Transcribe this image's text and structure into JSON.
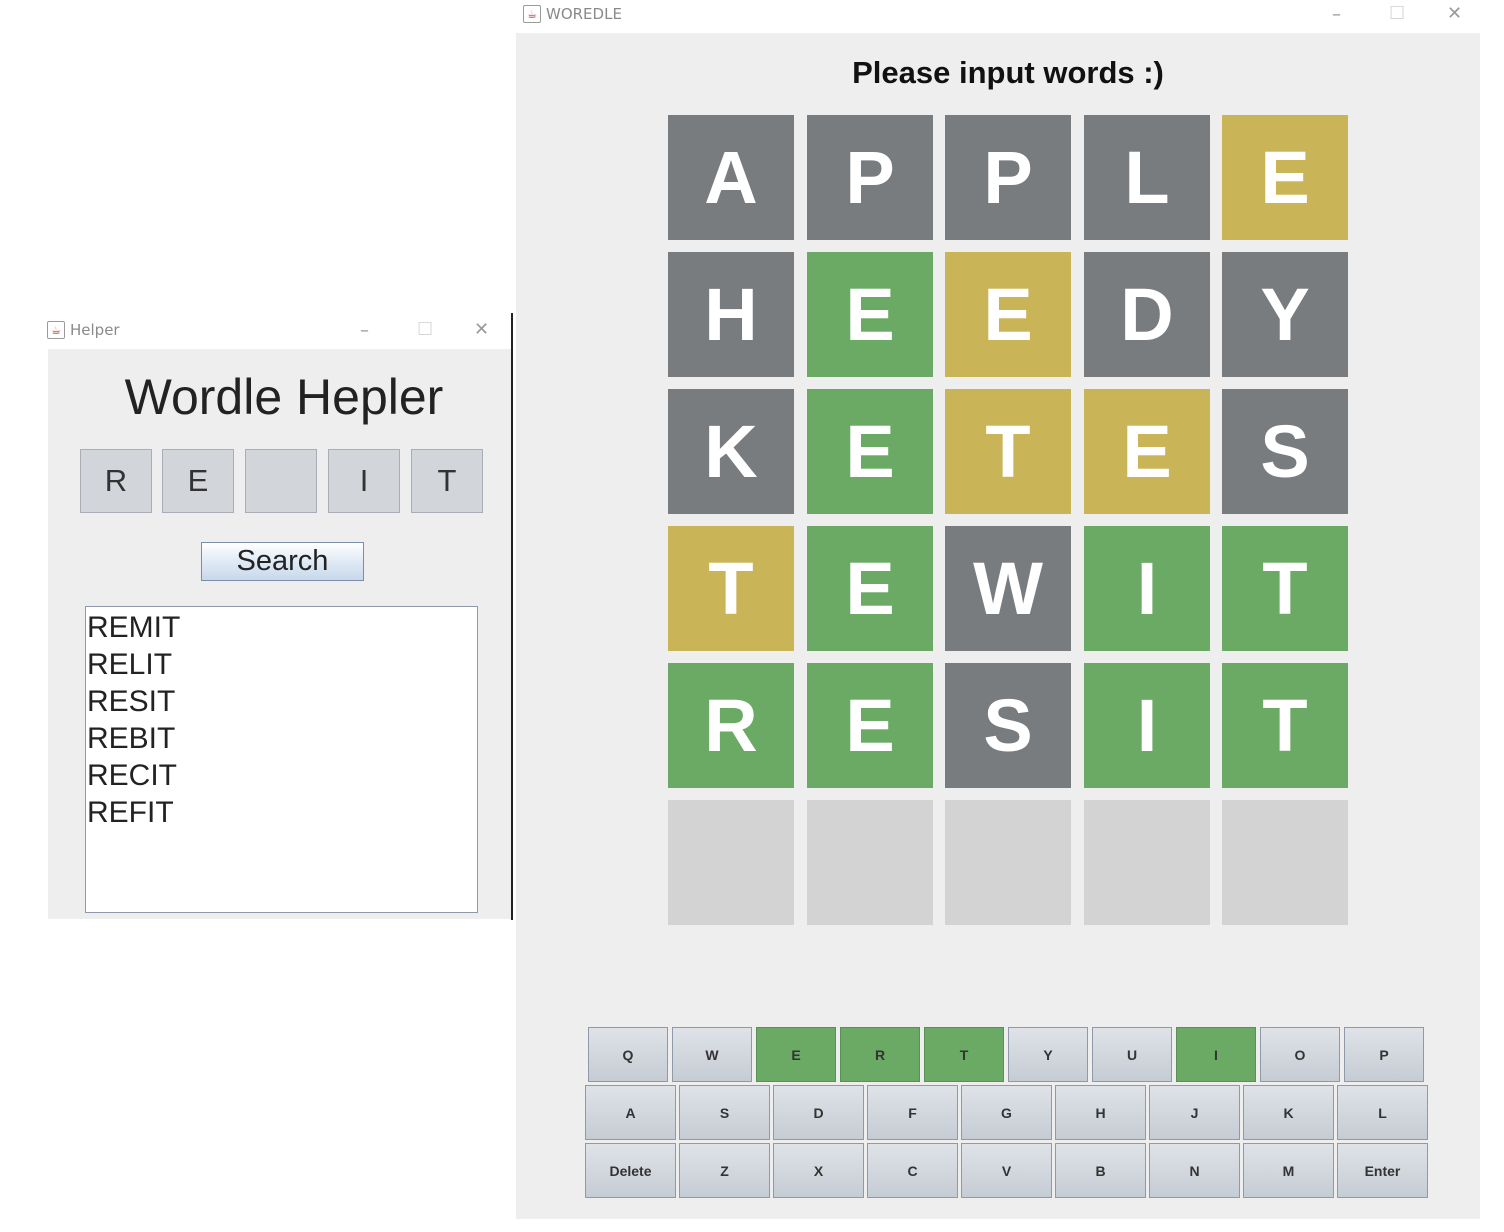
{
  "woredle_window": {
    "title": "WOREDLE",
    "heading": "Please input words :)",
    "board": [
      [
        {
          "letter": "A",
          "state": "gray"
        },
        {
          "letter": "P",
          "state": "gray"
        },
        {
          "letter": "P",
          "state": "gray"
        },
        {
          "letter": "L",
          "state": "gray"
        },
        {
          "letter": "E",
          "state": "yellow"
        }
      ],
      [
        {
          "letter": "H",
          "state": "gray"
        },
        {
          "letter": "E",
          "state": "green"
        },
        {
          "letter": "E",
          "state": "yellow"
        },
        {
          "letter": "D",
          "state": "gray"
        },
        {
          "letter": "Y",
          "state": "gray"
        }
      ],
      [
        {
          "letter": "K",
          "state": "gray"
        },
        {
          "letter": "E",
          "state": "green"
        },
        {
          "letter": "T",
          "state": "yellow"
        },
        {
          "letter": "E",
          "state": "yellow"
        },
        {
          "letter": "S",
          "state": "gray"
        }
      ],
      [
        {
          "letter": "T",
          "state": "yellow"
        },
        {
          "letter": "E",
          "state": "green"
        },
        {
          "letter": "W",
          "state": "gray"
        },
        {
          "letter": "I",
          "state": "green"
        },
        {
          "letter": "T",
          "state": "green"
        }
      ],
      [
        {
          "letter": "R",
          "state": "green"
        },
        {
          "letter": "E",
          "state": "green"
        },
        {
          "letter": "S",
          "state": "gray"
        },
        {
          "letter": "I",
          "state": "green"
        },
        {
          "letter": "T",
          "state": "green"
        }
      ],
      [
        {
          "letter": "",
          "state": "empty"
        },
        {
          "letter": "",
          "state": "empty"
        },
        {
          "letter": "",
          "state": "empty"
        },
        {
          "letter": "",
          "state": "empty"
        },
        {
          "letter": "",
          "state": "empty"
        }
      ]
    ],
    "keyboard": [
      [
        {
          "label": "Q",
          "state": "default"
        },
        {
          "label": "W",
          "state": "default"
        },
        {
          "label": "E",
          "state": "green"
        },
        {
          "label": "R",
          "state": "green"
        },
        {
          "label": "T",
          "state": "green"
        },
        {
          "label": "Y",
          "state": "default"
        },
        {
          "label": "U",
          "state": "default"
        },
        {
          "label": "I",
          "state": "green"
        },
        {
          "label": "O",
          "state": "default"
        },
        {
          "label": "P",
          "state": "default"
        }
      ],
      [
        {
          "label": "A",
          "state": "default"
        },
        {
          "label": "S",
          "state": "default"
        },
        {
          "label": "D",
          "state": "default"
        },
        {
          "label": "F",
          "state": "default"
        },
        {
          "label": "G",
          "state": "default"
        },
        {
          "label": "H",
          "state": "default"
        },
        {
          "label": "J",
          "state": "default"
        },
        {
          "label": "K",
          "state": "default"
        },
        {
          "label": "L",
          "state": "default"
        }
      ],
      [
        {
          "label": "Delete",
          "state": "default"
        },
        {
          "label": "Z",
          "state": "default"
        },
        {
          "label": "X",
          "state": "default"
        },
        {
          "label": "C",
          "state": "default"
        },
        {
          "label": "V",
          "state": "default"
        },
        {
          "label": "B",
          "state": "default"
        },
        {
          "label": "N",
          "state": "default"
        },
        {
          "label": "M",
          "state": "default"
        },
        {
          "label": "Enter",
          "state": "default"
        }
      ]
    ]
  },
  "helper_window": {
    "title": "Helper",
    "heading": "Wordle Hepler",
    "slots": [
      "R",
      "E",
      "",
      "I",
      "T"
    ],
    "search_label": "Search",
    "results": [
      "REMIT",
      "RELIT",
      "RESIT",
      "REBIT",
      "RECIT",
      "REFIT"
    ]
  },
  "colors": {
    "gray": "#787c7e",
    "green": "#6aaa64",
    "yellow": "#c9b458",
    "empty": "#d3d3d3",
    "window_bg": "#eeeeee"
  },
  "icons": {
    "app_icon": "java-cup-icon",
    "minimize": "–",
    "maximize": "☐",
    "close": "✕"
  }
}
